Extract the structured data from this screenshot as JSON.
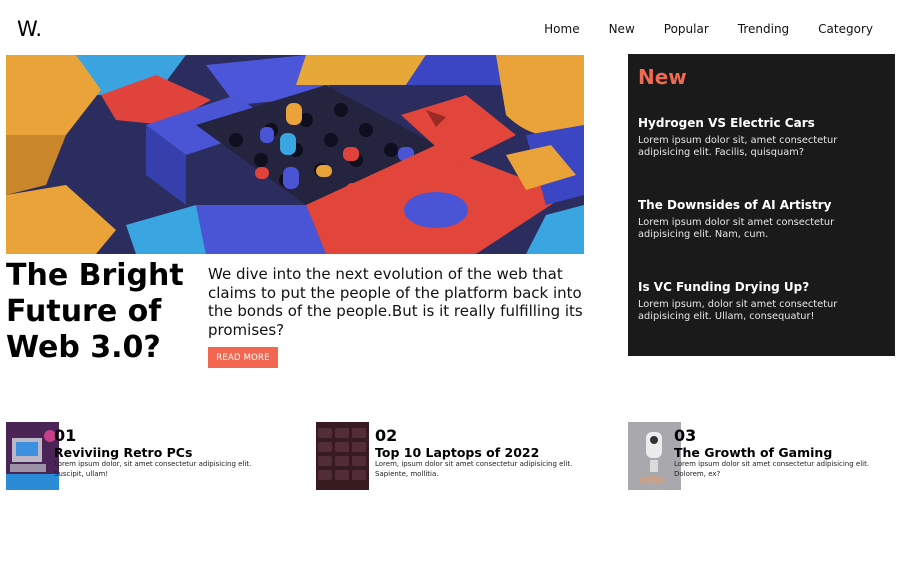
{
  "header": {
    "logo": "W.",
    "nav": [
      "Home",
      "New",
      "Popular",
      "Trending",
      "Category"
    ]
  },
  "hero": {
    "title": "The Bright Future of Web 3.0?",
    "description": "We dive into the next evolution of the web that claims to put the people of the platform back into the bonds of the people.But is it really fulfilling its promises?",
    "button": "READ MORE"
  },
  "new_panel": {
    "heading": "New",
    "items": [
      {
        "title": "Hydrogen VS Electric Cars",
        "text": "Lorem ipsum dolor sit, amet consectetur adipisicing elit. Facilis, quisquam?"
      },
      {
        "title": "The Downsides of AI Artistry",
        "text": "Lorem ipsum dolor sit amet consectetur adipisicing elit. Nam, cum."
      },
      {
        "title": "Is VC Funding Drying Up?",
        "text": "Lorem ipsum, dolor sit amet consectetur adipisicing elit. Ullam, consequatur!"
      }
    ]
  },
  "articles": [
    {
      "number": "01",
      "title": "Reviviing Retro PCs",
      "text": "Lorem ipsum dolor, sit amet consectetur adipisicing elit. Suscipit, ullam!"
    },
    {
      "number": "02",
      "title": "Top 10 Laptops of 2022",
      "text": "Lorem, ipsum dolor sit amet consectetur adipisicing elit. Sapiente, mollitia."
    },
    {
      "number": "03",
      "title": "The Growth of Gaming",
      "text": "Lorem ipsum dolor sit amet consectetur adipisicing elit. Dolorem, ex?"
    }
  ],
  "colors": {
    "accent": "#f3664f",
    "panel_bg": "#1a1a1a",
    "new_heading": "#ef6a52"
  }
}
